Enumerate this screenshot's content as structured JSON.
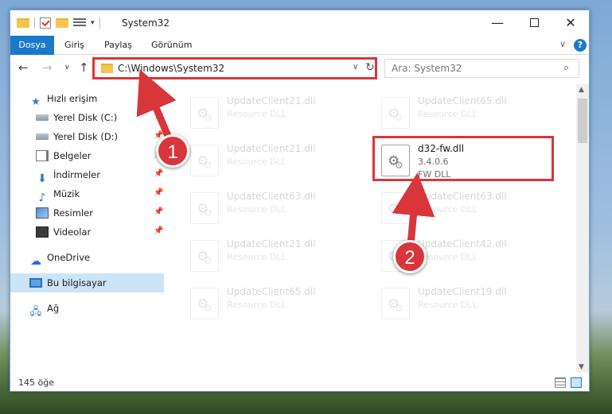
{
  "window": {
    "title": "System32",
    "minimize": "—",
    "close": "✕"
  },
  "quick_access_toolbar": {
    "dropdown_arrow": "▾"
  },
  "ribbon": {
    "tabs": [
      "Dosya",
      "Giriş",
      "Paylaş",
      "Görünüm"
    ],
    "expand_chevron": "∨",
    "help": "?"
  },
  "navigation": {
    "back": "←",
    "forward": "→",
    "recent": "∨",
    "up": "↑",
    "address": "C:\\Windows\\System32",
    "address_dropdown": "∨",
    "refresh": "↻",
    "search_placeholder": "Ara: System32",
    "search_icon": "⌕"
  },
  "sidebar": {
    "items": [
      {
        "label": "Hızlı erişim",
        "icon": "star-icon",
        "pinned": false
      },
      {
        "label": "Yerel Disk (C:)",
        "icon": "disk-icon",
        "pinned": true
      },
      {
        "label": "Yerel Disk (D:)",
        "icon": "disk-icon",
        "pinned": true
      },
      {
        "label": "Belgeler",
        "icon": "document-icon",
        "pinned": true
      },
      {
        "label": "İndirmeler",
        "icon": "download-icon",
        "pinned": true
      },
      {
        "label": "Müzik",
        "icon": "music-icon",
        "pinned": true
      },
      {
        "label": "Resimler",
        "icon": "picture-icon",
        "pinned": true
      },
      {
        "label": "Videolar",
        "icon": "video-icon",
        "pinned": true
      },
      {
        "label": "OneDrive",
        "icon": "cloud-icon",
        "pinned": false
      },
      {
        "label": "Bu bilgisayar",
        "icon": "computer-icon",
        "pinned": false,
        "selected": true
      },
      {
        "label": "Ağ",
        "icon": "network-icon",
        "pinned": false
      }
    ],
    "pin_glyph": "📌"
  },
  "files": [
    {
      "name": "UpdateClient21.dll",
      "line2": "Resource DLL",
      "line3": "",
      "faded": true
    },
    {
      "name": "UpdateClient65.dll",
      "line2": "Resource DLL",
      "line3": "",
      "faded": true
    },
    {
      "name": "UpdateClient21.dll",
      "line2": "Resource DLL",
      "line3": "",
      "faded": true
    },
    {
      "name": "d32-fw.dll",
      "line2": "3.4.0.6",
      "line3": "FW DLL",
      "faded": false
    },
    {
      "name": "UpdateClient63.dll",
      "line2": "Resource DLL",
      "line3": "",
      "faded": true
    },
    {
      "name": "UpdateClient63.dll",
      "line2": "Resource DLL",
      "line3": "",
      "faded": true
    },
    {
      "name": "UpdateClient21.dll",
      "line2": "Resource DLL",
      "line3": "",
      "faded": true
    },
    {
      "name": "UpdateClient42.dll",
      "line2": "Resource DLL",
      "line3": "",
      "faded": true
    },
    {
      "name": "UpdateClient65.dll",
      "line2": "Resource DLL",
      "line3": "",
      "faded": true
    },
    {
      "name": "UpdateClient19.dll",
      "line2": "Resource DLL",
      "line3": "",
      "faded": true
    }
  ],
  "status_bar": {
    "item_count": "145 öğe"
  },
  "scrollbar": {
    "up": "▲",
    "down": "▼"
  },
  "annotations": {
    "step1": "1",
    "step2": "2",
    "color": "#d8363a"
  }
}
